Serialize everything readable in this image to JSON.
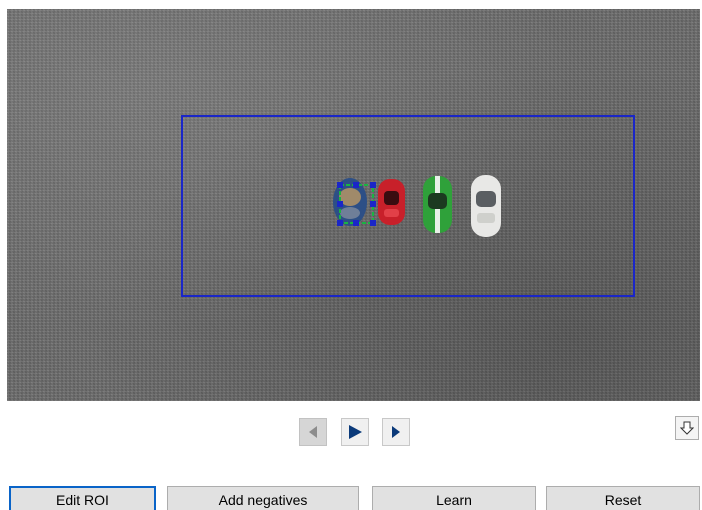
{
  "video": {
    "roi_color": "#1a26c8",
    "selection_color": "#19b443",
    "handle_color": "#1a26c8",
    "toy_cars": [
      "blue-car",
      "red-car",
      "green-car",
      "white-car"
    ]
  },
  "playback": {
    "prev_icon": "step-back-icon",
    "play_icon": "play-icon",
    "next_icon": "step-forward-icon",
    "download_icon": "down-arrow-icon"
  },
  "actions": {
    "edit_roi": "Edit ROI",
    "add_negatives": "Add negatives",
    "learn": "Learn",
    "reset": "Reset"
  },
  "colors": {
    "accent": "#0a64c8",
    "button_face": "#e1e1e1",
    "play_blue": "#0b3a7a"
  }
}
